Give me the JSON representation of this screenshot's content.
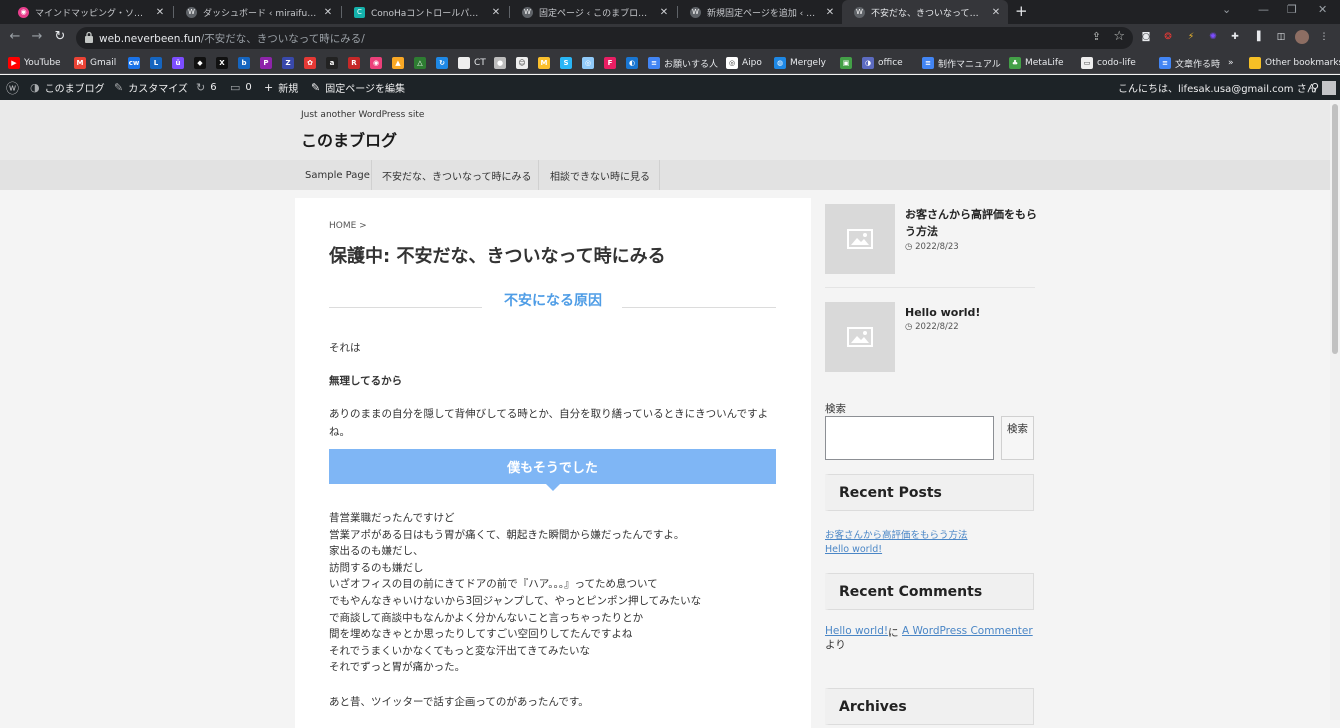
{
  "browser": {
    "tabs": [
      {
        "title": "マインドマッピング・ソフトウェア - オン",
        "color": "#e83e8c",
        "icon": "mindmap-icon"
      },
      {
        "title": "ダッシュボード ‹ miraiful — WordPress",
        "color": "#5f6368",
        "icon": "wordpress-icon"
      },
      {
        "title": "ConoHaコントロールパネル",
        "color": "#14b1ab",
        "icon": "conoha-icon"
      },
      {
        "title": "固定ページ ‹ このまブログ — WordPress",
        "color": "#5f6368",
        "icon": "wordpress-icon"
      },
      {
        "title": "新規固定ページを追加 ‹ このまブログ",
        "color": "#5f6368",
        "icon": "wordpress-icon"
      },
      {
        "title": "不安だな、きついなって時にみる - この",
        "color": "#5f6368",
        "icon": "wordpress-icon"
      }
    ],
    "new_tab": "+",
    "url_host": "web.neverbeen.fun",
    "url_path": "/不安だな、きついなって時にみる/",
    "bookmarks": [
      {
        "label": "YouTube",
        "color": "#ff0000",
        "glyph": "▶"
      },
      {
        "label": "Gmail",
        "color": "#ea4335",
        "glyph": "M"
      },
      {
        "label": "",
        "color": "#1a73e8",
        "glyph": "cw"
      },
      {
        "label": "",
        "color": "#1565c0",
        "glyph": "L"
      },
      {
        "label": "",
        "color": "#7c4dff",
        "glyph": "ü"
      },
      {
        "label": "",
        "color": "#111111",
        "glyph": "◆"
      },
      {
        "label": "",
        "color": "#111111",
        "glyph": "X"
      },
      {
        "label": "",
        "color": "#1565c0",
        "glyph": "b"
      },
      {
        "label": "",
        "color": "#8e24aa",
        "glyph": "P"
      },
      {
        "label": "",
        "color": "#3949ab",
        "glyph": "Z"
      },
      {
        "label": "",
        "color": "#e53935",
        "glyph": "✿"
      },
      {
        "label": "",
        "color": "#222222",
        "glyph": "a"
      },
      {
        "label": "",
        "color": "#c62828",
        "glyph": "R"
      },
      {
        "label": "",
        "color": "#ec407a",
        "glyph": "◉"
      },
      {
        "label": "",
        "color": "#f9a825",
        "glyph": "▲"
      },
      {
        "label": "",
        "color": "#2e7d32",
        "glyph": "△"
      },
      {
        "label": "",
        "color": "#1e88e5",
        "glyph": "↻"
      },
      {
        "label": "CT",
        "color": "#eeeeee",
        "glyph": ""
      },
      {
        "label": "",
        "color": "#bdbdbd",
        "glyph": "●"
      },
      {
        "label": "",
        "color": "#eeeeee",
        "glyph": "☺"
      },
      {
        "label": "",
        "color": "#fbc02d",
        "glyph": "M"
      },
      {
        "label": "",
        "color": "#29b6f6",
        "glyph": "S"
      },
      {
        "label": "",
        "color": "#90caf9",
        "glyph": "◎"
      },
      {
        "label": "",
        "color": "#e91e63",
        "glyph": "F"
      },
      {
        "label": "",
        "color": "#1976d2",
        "glyph": "◐"
      },
      {
        "label": "お願いする人",
        "color": "#4285f4",
        "glyph": "≡"
      },
      {
        "label": "Aipo",
        "color": "#ffffff",
        "glyph": "◎"
      },
      {
        "label": "Mergely",
        "color": "#1e88e5",
        "glyph": "◍"
      },
      {
        "label": "",
        "color": "#43a047",
        "glyph": "▣"
      },
      {
        "label": "office",
        "color": "#5c6bc0",
        "glyph": "◑"
      },
      {
        "label": "制作マニュアル",
        "color": "#4285f4",
        "glyph": "≡"
      },
      {
        "label": "MetaLife",
        "color": "#43a047",
        "glyph": "♣"
      },
      {
        "label": "codo-life",
        "color": "#eeeeee",
        "glyph": "▭"
      },
      {
        "label": "文章作る時",
        "color": "#4285f4",
        "glyph": "≡"
      }
    ],
    "bookmarks_more": "»",
    "other_bookmarks": "Other bookmarks"
  },
  "adminbar": {
    "site_name": "このまブログ",
    "customize": "カスタマイズ",
    "updates": "6",
    "comments": "0",
    "new": "新規",
    "edit": "固定ページを編集",
    "greeting": "こんにちは、lifesak.usa@gmail.com さん"
  },
  "site": {
    "tagline": "Just another WordPress site",
    "title": "このまブログ",
    "nav": [
      "Sample Page",
      "不安だな、きついなって時にみる",
      "相談できない時に見る"
    ]
  },
  "article": {
    "breadcrumb": "HOME >",
    "title": "保護中: 不安だな、きついなって時にみる",
    "heading": "不安になる原因",
    "p1": "それは",
    "p2": "無理してるから",
    "p3a": "ありのままの自分を隠して背伸びしてる時とか、自分を取り繕っているときにきついんですよ",
    "p3b": "ね。",
    "banner": "僕もそうでした",
    "lines": [
      "昔営業職だったんですけど",
      "営業アポがある日はもう胃が痛くて、朝起きた瞬間から嫌だったんですよ。",
      "家出るのも嫌だし、",
      "訪問するのも嫌だし",
      "いざオフィスの目の前にきてドアの前で『ハア。。。』ってため息ついて",
      "でもやんなきゃいけないから3回ジャンプして、やっとピンポン押してみたいな",
      "で商談して商談中もなんかよく分かんないこと言っちゃったりとか",
      "間を埋めなきゃとか思ったりしてすごい空回りしてたんですよね",
      "それでうまくいかなくてもっと変な汗出てきてみたいな",
      "それでずっと胃が痛かった。"
    ],
    "p4": "あと昔、ツイッターで話す企画ってのがあったんです。"
  },
  "sidebar": {
    "posts": [
      {
        "title": "お客さんから高評価をもらう方法",
        "date": "2022/8/23"
      },
      {
        "title": "Hello world!",
        "date": "2022/8/22"
      }
    ],
    "search_label": "検索",
    "search_button": "検索",
    "recent_posts_title": "Recent Posts",
    "recent_posts": [
      "お客さんから高評価をもらう方法",
      "Hello world!"
    ],
    "recent_comments_title": "Recent Comments",
    "comment_post": "Hello world!",
    "comment_ni": "に",
    "comment_author": "A WordPress Commenter",
    "comment_yori": "より",
    "archives_title": "Archives"
  }
}
